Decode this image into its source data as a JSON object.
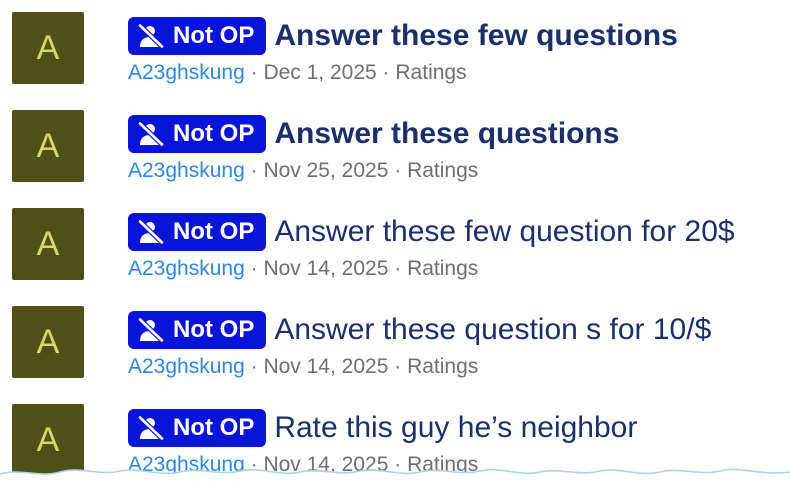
{
  "threads": [
    {
      "avatar_letter": "A",
      "badge_label": "Not OP",
      "title": "Answer these few questions",
      "author": "A23ghskung",
      "date": "Dec 1, 2025",
      "section": "Ratings"
    },
    {
      "avatar_letter": "A",
      "badge_label": "Not OP",
      "title": "Answer these questions",
      "author": "A23ghskung",
      "date": "Nov 25, 2025",
      "section": "Ratings"
    },
    {
      "avatar_letter": "A",
      "badge_label": "Not OP",
      "title": "Answer these few question for 20$",
      "author": "A23ghskung",
      "date": "Nov 14, 2025",
      "section": "Ratings"
    },
    {
      "avatar_letter": "A",
      "badge_label": "Not OP",
      "title": "Answer these question s for 10/$",
      "author": "A23ghskung",
      "date": "Nov 14, 2025",
      "section": "Ratings"
    },
    {
      "avatar_letter": "A",
      "badge_label": "Not OP",
      "title": "Rate this guy he’s neighbor",
      "author": "A23ghskung",
      "date": "Nov 14, 2025",
      "section": "Ratings"
    }
  ],
  "separator": "·",
  "colors": {
    "badge_bg": "#0a14d8",
    "title_text": "#1d2f6b",
    "author_link": "#2f88df",
    "avatar_bg": "#4f4f18",
    "avatar_letter": "#d6d86a"
  },
  "icons": {
    "badge_icon": "user-slash-icon"
  }
}
